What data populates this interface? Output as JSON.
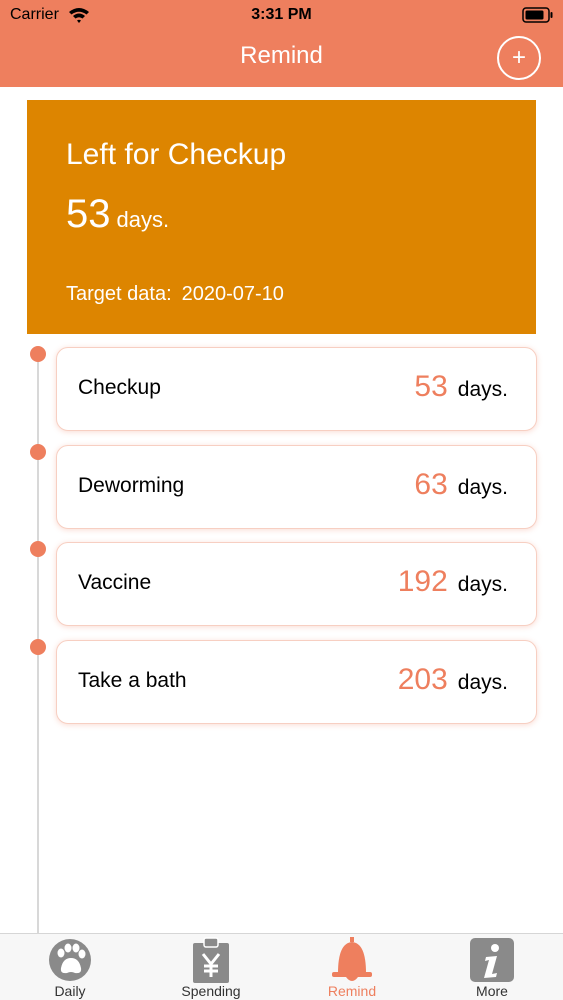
{
  "status_bar": {
    "carrier": "Carrier",
    "time": "3:31 PM"
  },
  "nav": {
    "title": "Remind",
    "add_label": "+"
  },
  "summary": {
    "title": "Left for Checkup",
    "days": "53",
    "days_unit": "days.",
    "target_label": "Target data:",
    "target_date": "2020-07-10"
  },
  "reminders": [
    {
      "name": "Checkup",
      "days": "53",
      "unit": "days."
    },
    {
      "name": "Deworming",
      "days": "63",
      "unit": "days."
    },
    {
      "name": "Vaccine",
      "days": "192",
      "unit": "days."
    },
    {
      "name": "Take a bath",
      "days": "203",
      "unit": "days."
    }
  ],
  "tabs": [
    {
      "label": "Daily",
      "icon": "paw-icon"
    },
    {
      "label": "Spending",
      "icon": "yen-clipboard-icon"
    },
    {
      "label": "Remind",
      "icon": "bell-icon",
      "active": true
    },
    {
      "label": "More",
      "icon": "info-icon"
    }
  ],
  "colors": {
    "accent": "#ee7f5e",
    "summary_card": "#dd8500",
    "tab_inactive": "#888888"
  }
}
